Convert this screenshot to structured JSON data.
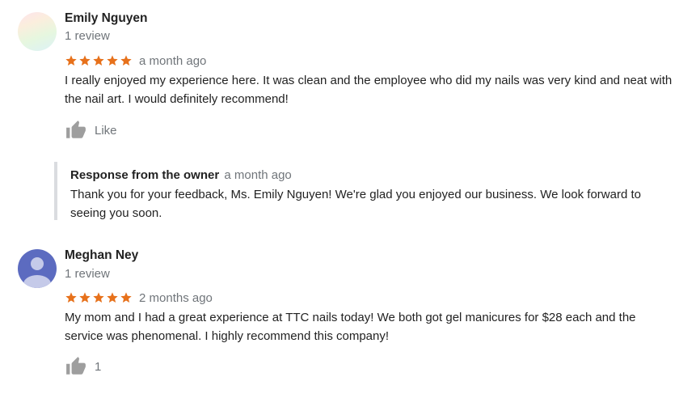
{
  "reviews": [
    {
      "author": "Emily Nguyen",
      "review_count": "1 review",
      "rating": 5,
      "date": "a month ago",
      "text": "I really enjoyed my experience here. It was clean and the employee who did my nails was very kind and neat with the nail art. I would definitely recommend!",
      "like_label": "Like",
      "owner_response": {
        "title": "Response from the owner",
        "date": "a month ago",
        "text": "Thank you for your feedback, Ms. Emily Nguyen! We're glad you enjoyed our business. We look forward to seeing you soon."
      }
    },
    {
      "author": "Meghan Ney",
      "review_count": "1 review",
      "rating": 5,
      "date": "2 months ago",
      "text": "My mom and I had a great experience at TTC nails today! We both got gel manicures for $28 each and the service was phenomenal. I highly recommend this company!",
      "like_label": "1"
    }
  ],
  "colors": {
    "star": "#e7711b",
    "secondary_text": "#70757a",
    "thumb": "#9e9e9e",
    "avatar_person_bg": "#5c6bc0",
    "owner_border": "#dadce0"
  },
  "icons": {
    "star": "star-icon",
    "thumb": "thumbs-up-icon",
    "avatar_default": "person-silhouette"
  }
}
